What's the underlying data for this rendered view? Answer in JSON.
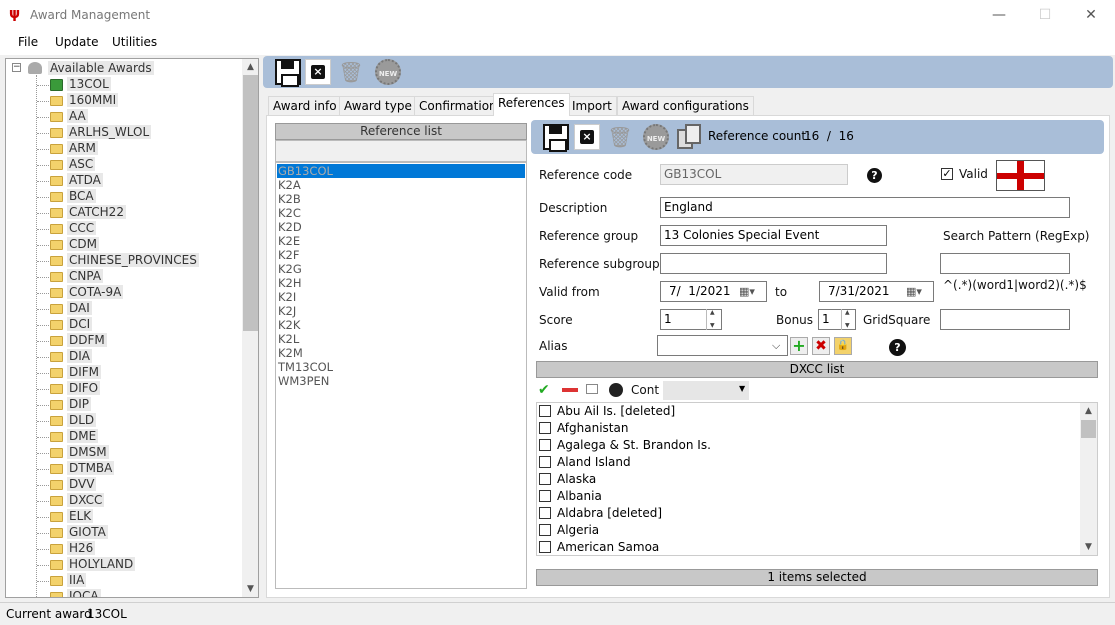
{
  "window": {
    "title": "Award Management",
    "minimize": "—",
    "maximize": "☐",
    "close": "✕"
  },
  "menu": {
    "file": "File",
    "update": "Update",
    "utilities": "Utilities"
  },
  "tree": {
    "root_label": "Available Awards",
    "items": [
      "13COL",
      "160MMI",
      "AA",
      "ARLHS_WLOL",
      "ARM",
      "ASC",
      "ATDA",
      "BCA",
      "CATCH22",
      "CCC",
      "CDM",
      "CHINESE_PROVINCES",
      "CNPA",
      "COTA-9A",
      "DAI",
      "DCI",
      "DDFM",
      "DIA",
      "DIFM",
      "DIFO",
      "DIP",
      "DLD",
      "DME",
      "DMSM",
      "DTMBA",
      "DVV",
      "DXCC",
      "ELK",
      "GIOTA",
      "H26",
      "HOLYLAND",
      "IIA",
      "IOCA"
    ]
  },
  "status": {
    "current_award_label": "Current award",
    "current_award_value": "13COL"
  },
  "tabs": [
    "Award info",
    "Award type",
    "Confirmation",
    "References",
    "Import",
    "Award configurations"
  ],
  "active_tab": "References",
  "reference_list": {
    "header": "Reference list",
    "items": [
      "GB13COL",
      "K2A",
      "K2B",
      "K2C",
      "K2D",
      "K2E",
      "K2F",
      "K2G",
      "K2H",
      "K2I",
      "K2J",
      "K2K",
      "K2L",
      "K2M",
      "TM13COL",
      "WM3PEN"
    ]
  },
  "ref_toolbar": {
    "count_label": "Reference count:",
    "count_value": "16  /  16",
    "new_label": "NEW"
  },
  "main_toolbar": {
    "new_label": "NEW"
  },
  "form": {
    "reference_code_label": "Reference code",
    "reference_code_value": "GB13COL",
    "valid_label": "Valid",
    "valid_checked": "✓",
    "description_label": "Description",
    "description_value": "England",
    "group_label": "Reference group",
    "group_value": "13 Colonies Special Event",
    "search_pattern_label": "Search Pattern (RegExp)",
    "search_pattern_value": "",
    "search_pattern_hint": "^(.*)(word1|word2)(.*)$",
    "subgroup_label": "Reference subgroup",
    "subgroup_value": "",
    "valid_from_label": "Valid from",
    "valid_from_value": "7/  1/2021",
    "to_label": "to",
    "valid_to_value": "7/31/2021",
    "score_label": "Score",
    "score_value": "1",
    "bonus_label": "Bonus",
    "bonus_value": "1",
    "gridsquare_label": "GridSquare",
    "gridsquare_value": "",
    "alias_label": "Alias",
    "alias_value": "",
    "help": "?"
  },
  "dxcc": {
    "header": "DXCC list",
    "cont_label": "Cont",
    "cont_value": "",
    "items": [
      "Abu Ail Is. [deleted]",
      "Afghanistan",
      "Agalega & St. Brandon Is.",
      "Aland Island",
      "Alaska",
      "Albania",
      "Aldabra [deleted]",
      "Algeria",
      "American Samoa"
    ],
    "selected_text": "1 items selected"
  },
  "colors": {
    "toolbar_bg": "#a9bed8",
    "selection": "#0078d7",
    "flag_red": "#cc0000"
  }
}
